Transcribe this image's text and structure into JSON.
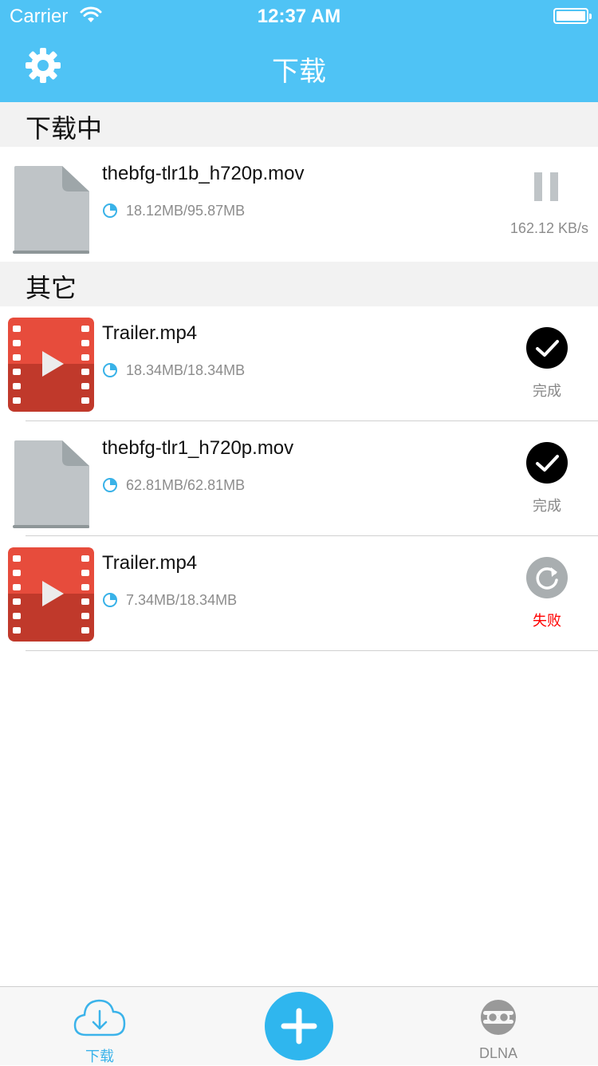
{
  "status_bar": {
    "carrier": "Carrier",
    "time": "12:37 AM"
  },
  "nav": {
    "title": "下载",
    "settings_icon": "gear-icon"
  },
  "sections": [
    {
      "title": "下载中"
    },
    {
      "title": "其它"
    }
  ],
  "downloading": [
    {
      "name": "thebfg-tlr1b_h720p.mov",
      "size": "18.12MB/95.87MB",
      "speed": "162.12 KB/s",
      "icon": "file-icon",
      "action": "pause-icon"
    }
  ],
  "others": [
    {
      "name": "Trailer.mp4",
      "size": "18.34MB/18.34MB",
      "status": "完成",
      "icon": "video-icon",
      "action": "check-icon"
    },
    {
      "name": "thebfg-tlr1_h720p.mov",
      "size": "62.81MB/62.81MB",
      "status": "完成",
      "icon": "file-icon",
      "action": "check-icon"
    },
    {
      "name": "Trailer.mp4",
      "size": "7.34MB/18.34MB",
      "status": "失败",
      "icon": "video-icon",
      "action": "retry-icon"
    }
  ],
  "tabbar": {
    "download_label": "下载",
    "dlna_label": "DLNA"
  },
  "colors": {
    "accent": "#4FC3F5",
    "fail": "#FF0000",
    "done": "#888888"
  }
}
